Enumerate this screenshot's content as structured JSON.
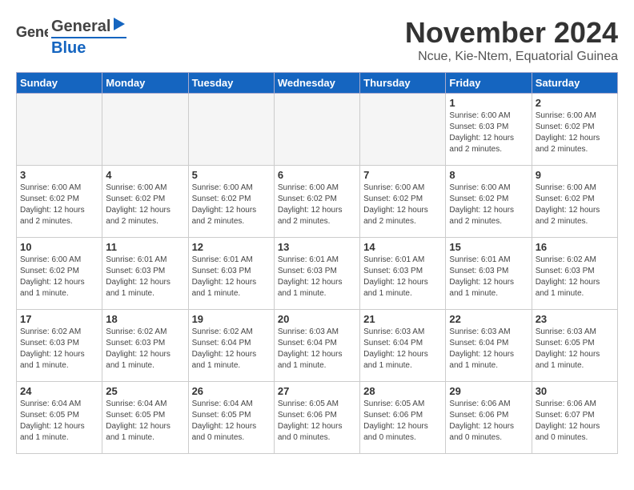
{
  "logo": {
    "general": "General",
    "blue": "Blue",
    "arrow": "▶"
  },
  "title": "November 2024",
  "subtitle": "Ncue, Kie-Ntem, Equatorial Guinea",
  "headers": [
    "Sunday",
    "Monday",
    "Tuesday",
    "Wednesday",
    "Thursday",
    "Friday",
    "Saturday"
  ],
  "weeks": [
    [
      {
        "day": "",
        "info": ""
      },
      {
        "day": "",
        "info": ""
      },
      {
        "day": "",
        "info": ""
      },
      {
        "day": "",
        "info": ""
      },
      {
        "day": "",
        "info": ""
      },
      {
        "day": "1",
        "info": "Sunrise: 6:00 AM\nSunset: 6:03 PM\nDaylight: 12 hours\nand 2 minutes."
      },
      {
        "day": "2",
        "info": "Sunrise: 6:00 AM\nSunset: 6:02 PM\nDaylight: 12 hours\nand 2 minutes."
      }
    ],
    [
      {
        "day": "3",
        "info": "Sunrise: 6:00 AM\nSunset: 6:02 PM\nDaylight: 12 hours\nand 2 minutes."
      },
      {
        "day": "4",
        "info": "Sunrise: 6:00 AM\nSunset: 6:02 PM\nDaylight: 12 hours\nand 2 minutes."
      },
      {
        "day": "5",
        "info": "Sunrise: 6:00 AM\nSunset: 6:02 PM\nDaylight: 12 hours\nand 2 minutes."
      },
      {
        "day": "6",
        "info": "Sunrise: 6:00 AM\nSunset: 6:02 PM\nDaylight: 12 hours\nand 2 minutes."
      },
      {
        "day": "7",
        "info": "Sunrise: 6:00 AM\nSunset: 6:02 PM\nDaylight: 12 hours\nand 2 minutes."
      },
      {
        "day": "8",
        "info": "Sunrise: 6:00 AM\nSunset: 6:02 PM\nDaylight: 12 hours\nand 2 minutes."
      },
      {
        "day": "9",
        "info": "Sunrise: 6:00 AM\nSunset: 6:02 PM\nDaylight: 12 hours\nand 2 minutes."
      }
    ],
    [
      {
        "day": "10",
        "info": "Sunrise: 6:00 AM\nSunset: 6:02 PM\nDaylight: 12 hours\nand 1 minute."
      },
      {
        "day": "11",
        "info": "Sunrise: 6:01 AM\nSunset: 6:03 PM\nDaylight: 12 hours\nand 1 minute."
      },
      {
        "day": "12",
        "info": "Sunrise: 6:01 AM\nSunset: 6:03 PM\nDaylight: 12 hours\nand 1 minute."
      },
      {
        "day": "13",
        "info": "Sunrise: 6:01 AM\nSunset: 6:03 PM\nDaylight: 12 hours\nand 1 minute."
      },
      {
        "day": "14",
        "info": "Sunrise: 6:01 AM\nSunset: 6:03 PM\nDaylight: 12 hours\nand 1 minute."
      },
      {
        "day": "15",
        "info": "Sunrise: 6:01 AM\nSunset: 6:03 PM\nDaylight: 12 hours\nand 1 minute."
      },
      {
        "day": "16",
        "info": "Sunrise: 6:02 AM\nSunset: 6:03 PM\nDaylight: 12 hours\nand 1 minute."
      }
    ],
    [
      {
        "day": "17",
        "info": "Sunrise: 6:02 AM\nSunset: 6:03 PM\nDaylight: 12 hours\nand 1 minute."
      },
      {
        "day": "18",
        "info": "Sunrise: 6:02 AM\nSunset: 6:03 PM\nDaylight: 12 hours\nand 1 minute."
      },
      {
        "day": "19",
        "info": "Sunrise: 6:02 AM\nSunset: 6:04 PM\nDaylight: 12 hours\nand 1 minute."
      },
      {
        "day": "20",
        "info": "Sunrise: 6:03 AM\nSunset: 6:04 PM\nDaylight: 12 hours\nand 1 minute."
      },
      {
        "day": "21",
        "info": "Sunrise: 6:03 AM\nSunset: 6:04 PM\nDaylight: 12 hours\nand 1 minute."
      },
      {
        "day": "22",
        "info": "Sunrise: 6:03 AM\nSunset: 6:04 PM\nDaylight: 12 hours\nand 1 minute."
      },
      {
        "day": "23",
        "info": "Sunrise: 6:03 AM\nSunset: 6:05 PM\nDaylight: 12 hours\nand 1 minute."
      }
    ],
    [
      {
        "day": "24",
        "info": "Sunrise: 6:04 AM\nSunset: 6:05 PM\nDaylight: 12 hours\nand 1 minute."
      },
      {
        "day": "25",
        "info": "Sunrise: 6:04 AM\nSunset: 6:05 PM\nDaylight: 12 hours\nand 1 minute."
      },
      {
        "day": "26",
        "info": "Sunrise: 6:04 AM\nSunset: 6:05 PM\nDaylight: 12 hours\nand 0 minutes."
      },
      {
        "day": "27",
        "info": "Sunrise: 6:05 AM\nSunset: 6:06 PM\nDaylight: 12 hours\nand 0 minutes."
      },
      {
        "day": "28",
        "info": "Sunrise: 6:05 AM\nSunset: 6:06 PM\nDaylight: 12 hours\nand 0 minutes."
      },
      {
        "day": "29",
        "info": "Sunrise: 6:06 AM\nSunset: 6:06 PM\nDaylight: 12 hours\nand 0 minutes."
      },
      {
        "day": "30",
        "info": "Sunrise: 6:06 AM\nSunset: 6:07 PM\nDaylight: 12 hours\nand 0 minutes."
      }
    ]
  ]
}
